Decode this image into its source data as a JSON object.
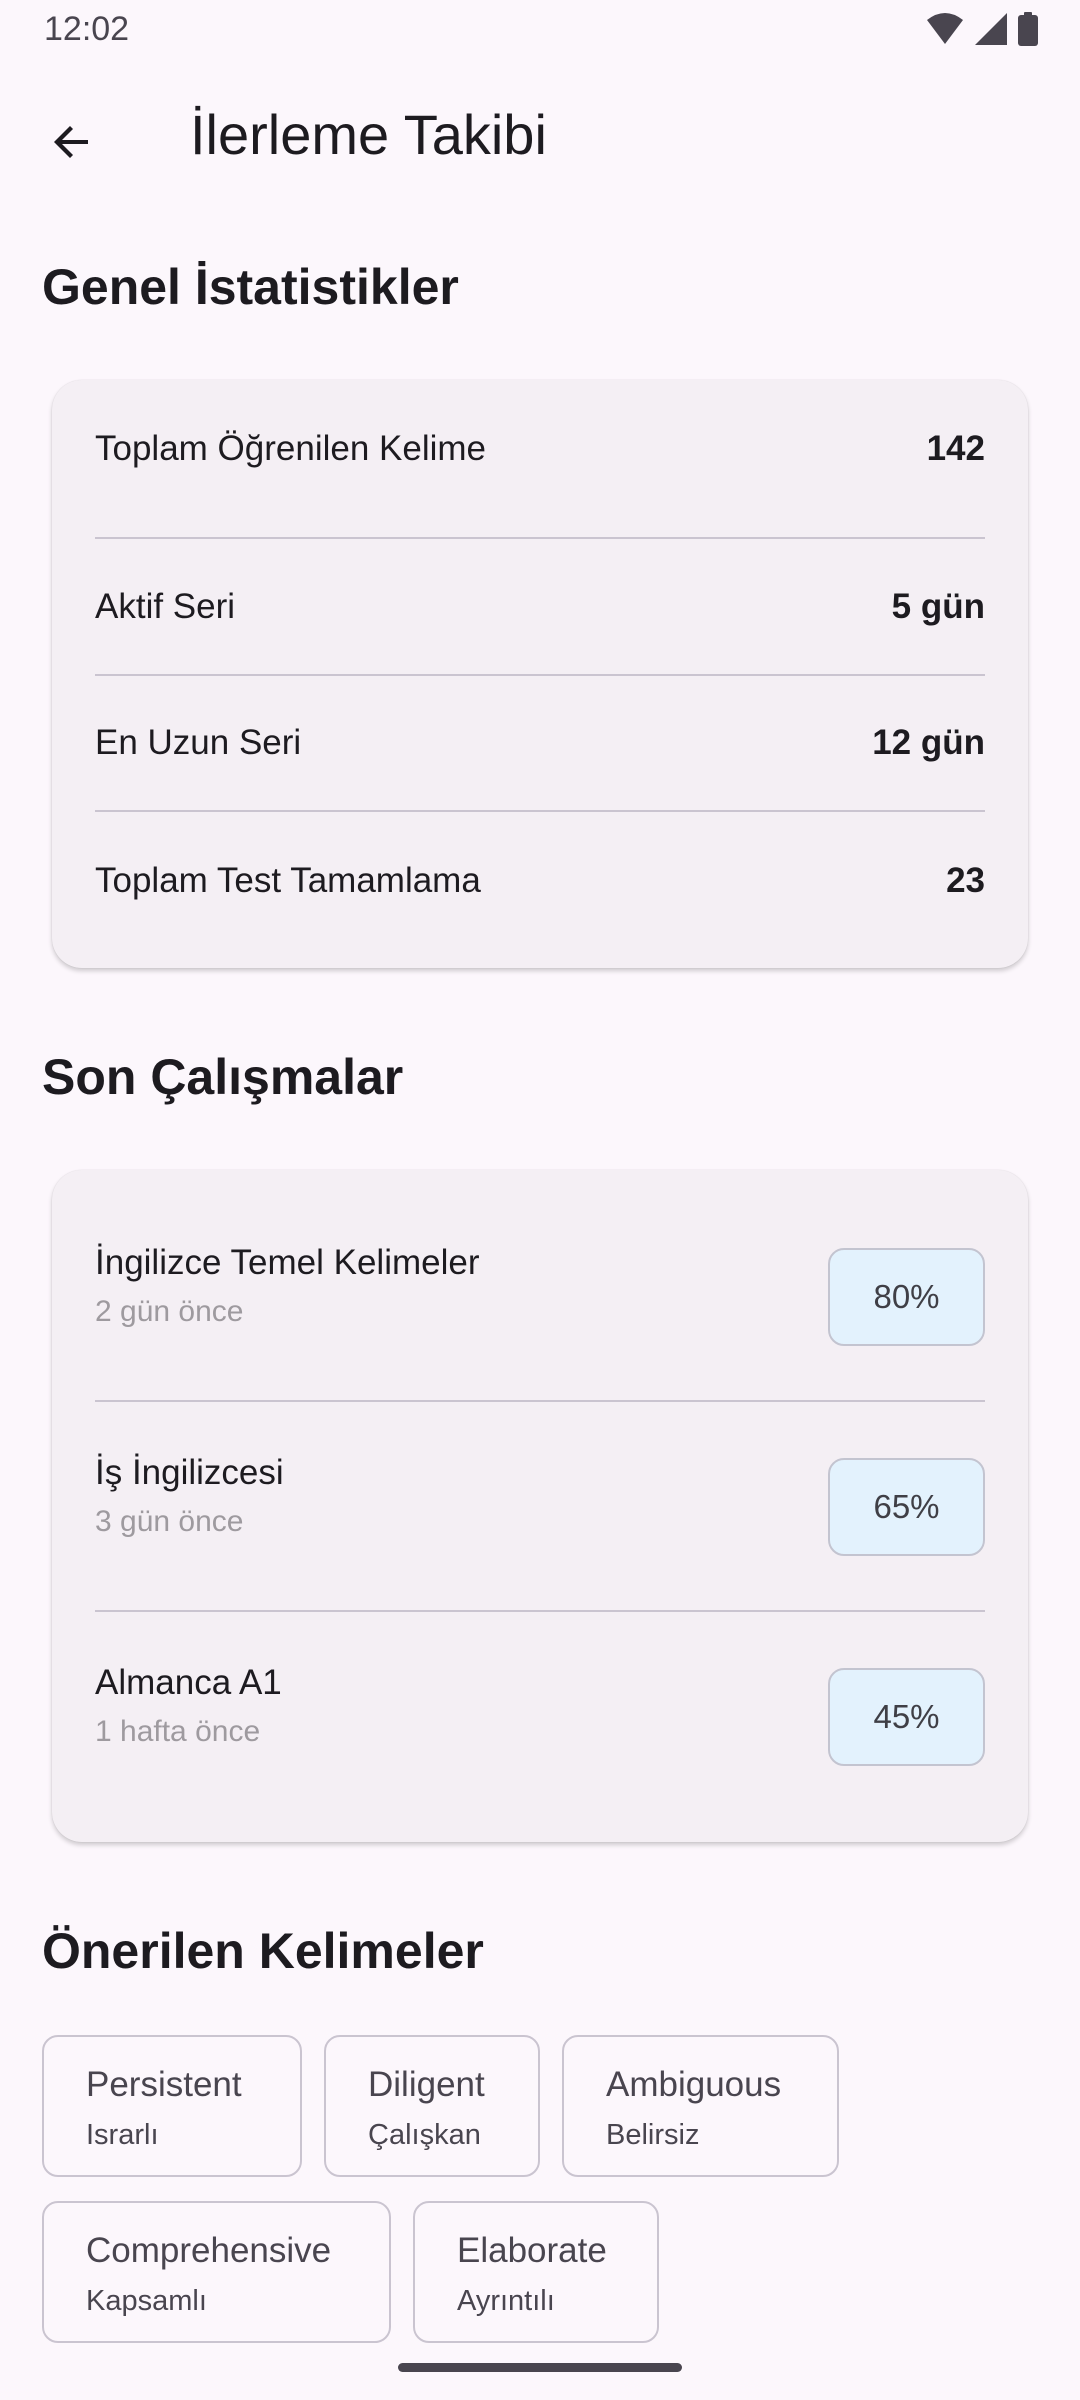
{
  "status_bar": {
    "time": "12:02",
    "icons": [
      "wifi-icon",
      "signal-icon",
      "battery-icon"
    ]
  },
  "app_bar": {
    "back_icon": "arrow-back-icon",
    "title": "İlerleme Takibi"
  },
  "general_stats": {
    "title": "Genel İstatistikler",
    "rows": [
      {
        "label": "Toplam Öğrenilen Kelime",
        "value": "142"
      },
      {
        "label": "Aktif Seri",
        "value": "5 gün"
      },
      {
        "label": "En Uzun Seri",
        "value": "12 gün"
      },
      {
        "label": "Toplam Test Tamamlama",
        "value": "23"
      }
    ]
  },
  "recent": {
    "title": "Son Çalışmalar",
    "items": [
      {
        "name": "İngilizce Temel Kelimeler",
        "when": "2 gün önce",
        "percent": "80%"
      },
      {
        "name": "İş İngilizcesi",
        "when": "3 gün önce",
        "percent": "65%"
      },
      {
        "name": "Almanca A1",
        "when": "1 hafta önce",
        "percent": "45%"
      }
    ]
  },
  "suggested": {
    "title": "Önerilen Kelimeler",
    "chips": [
      {
        "word": "Persistent",
        "translation": "Israrlı"
      },
      {
        "word": "Diligent",
        "translation": "Çalışkan"
      },
      {
        "word": "Ambiguous",
        "translation": "Belirsiz"
      },
      {
        "word": "Comprehensive",
        "translation": "Kapsamlı"
      },
      {
        "word": "Elaborate",
        "translation": "Ayrıntılı"
      }
    ]
  },
  "colors": {
    "background": "#fcf7fc",
    "card": "#f4eff4",
    "badge": "#e3f2fd",
    "text": "#1d1b20",
    "muted": "#9e9a9f"
  }
}
